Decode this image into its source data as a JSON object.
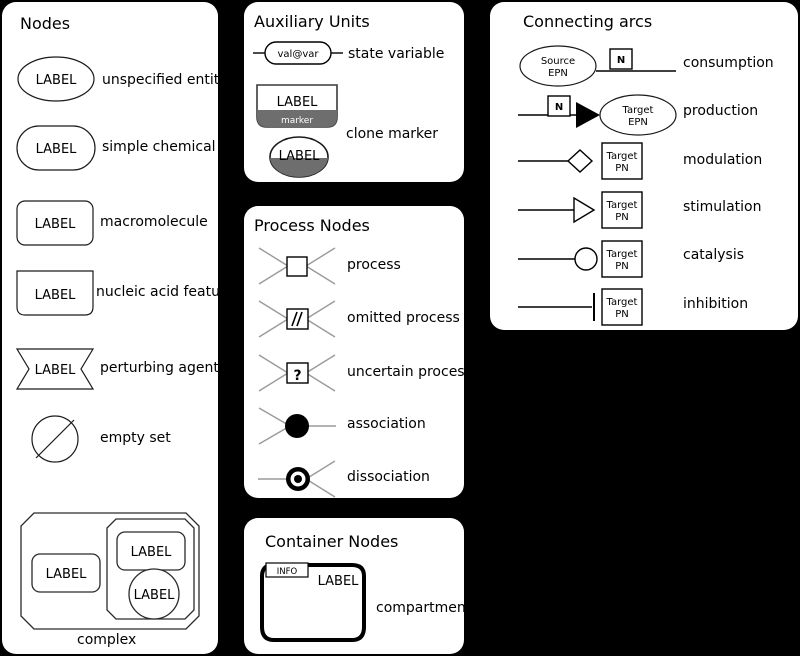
{
  "background_color": "#000000",
  "panel_color": "#ffffff",
  "panels": {
    "nodes": {
      "title": "Nodes",
      "rows": [
        {
          "label": "unspecified entity",
          "glyph": "ellipse-label",
          "glyph_text": "LABEL"
        },
        {
          "label": "simple chemical",
          "glyph": "stadium-label",
          "glyph_text": "LABEL"
        },
        {
          "label": "macromolecule",
          "glyph": "rounded-rect-label",
          "glyph_text": "LABEL"
        },
        {
          "label": "nucleic acid feature",
          "glyph": "bottom-rounded-rect-label",
          "glyph_text": "LABEL"
        },
        {
          "label": "perturbing agent",
          "glyph": "concave-hexagon-label",
          "glyph_text": "LABEL"
        },
        {
          "label": "empty set",
          "glyph": "circle-with-slash",
          "glyph_text": ""
        }
      ],
      "complex": {
        "caption": "complex",
        "inner_labels": [
          "LABEL",
          "LABEL",
          "LABEL"
        ]
      }
    },
    "auxiliary_units": {
      "title": "Auxiliary Units",
      "rows": [
        {
          "label": "state variable",
          "glyph": "state-variable",
          "glyph_text": "val@var"
        },
        {
          "label": "clone marker",
          "glyph": "clone-marker",
          "glyph_text": "LABEL",
          "marker_text": "marker"
        }
      ],
      "clone_ellipse_text": "LABEL",
      "marker_color": "#6e6e6e"
    },
    "process_nodes": {
      "title": "Process Nodes",
      "rows": [
        {
          "label": "process",
          "glyph": "square-process",
          "glyph_text": ""
        },
        {
          "label": "omitted process",
          "glyph": "omitted-process",
          "glyph_text": "\\\\"
        },
        {
          "label": "uncertain process",
          "glyph": "uncertain-process",
          "glyph_text": "?"
        },
        {
          "label": "association",
          "glyph": "filled-circle-process",
          "glyph_text": ""
        },
        {
          "label": "dissociation",
          "glyph": "donut-process",
          "glyph_text": ""
        }
      ]
    },
    "container_nodes": {
      "title": "Container Nodes",
      "rows": [
        {
          "label": "compartment",
          "glyph": "compartment",
          "info_text": "INFO",
          "glyph_text": "LABEL"
        }
      ]
    },
    "connecting_arcs": {
      "title": "Connecting arcs",
      "rows": [
        {
          "label": "consumption",
          "glyph": "consumption",
          "source_text": "Source\nEPN",
          "cardinality": "N"
        },
        {
          "label": "production",
          "glyph": "production",
          "target_text": "Target\nEPN",
          "cardinality": "N"
        },
        {
          "label": "modulation",
          "glyph": "modulation",
          "target_text": "Target\nPN"
        },
        {
          "label": "stimulation",
          "glyph": "stimulation",
          "target_text": "Target\nPN"
        },
        {
          "label": "catalysis",
          "glyph": "catalysis",
          "target_text": "Target\nPN"
        },
        {
          "label": "inhibition",
          "glyph": "inhibition",
          "target_text": "Target\nPN"
        }
      ],
      "source_epn_line1": "Source",
      "source_epn_line2": "EPN",
      "target_epn_line1": "Target",
      "target_epn_line2": "EPN",
      "target_pn_line1": "Target",
      "target_pn_line2": "PN",
      "cardinality_label": "N"
    }
  }
}
